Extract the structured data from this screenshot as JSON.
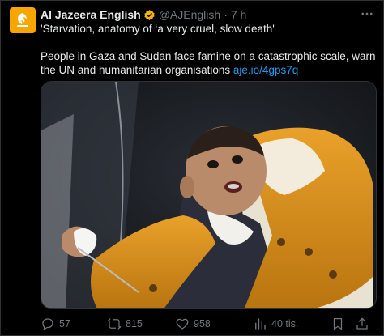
{
  "tweet": {
    "author_name": "Al Jazeera English",
    "handle": "@AJEnglish",
    "separator": "·",
    "time": "7 h",
    "text_line1": "'Starvation, anatomy of ‘a very cruel, slow death'",
    "text_line2": "People in Gaza and Sudan face famine on a catastrophic scale, warn the UN and humanitarian organisations",
    "link": "aje.io/4gps7q"
  },
  "actions": {
    "replies": "57",
    "reposts": "815",
    "likes": "958",
    "views": "40 tis."
  },
  "colors": {
    "background": "#000000",
    "text": "#e7e9ea",
    "muted": "#71767b",
    "link": "#1d9bf0",
    "avatar": "#f7a600",
    "verified": "#f4b400"
  },
  "icons": [
    "aljazeera-logo-icon",
    "verified-badge-icon",
    "more-icon",
    "reply-icon",
    "repost-icon",
    "like-icon",
    "views-icon",
    "bookmark-icon",
    "share-icon"
  ]
}
